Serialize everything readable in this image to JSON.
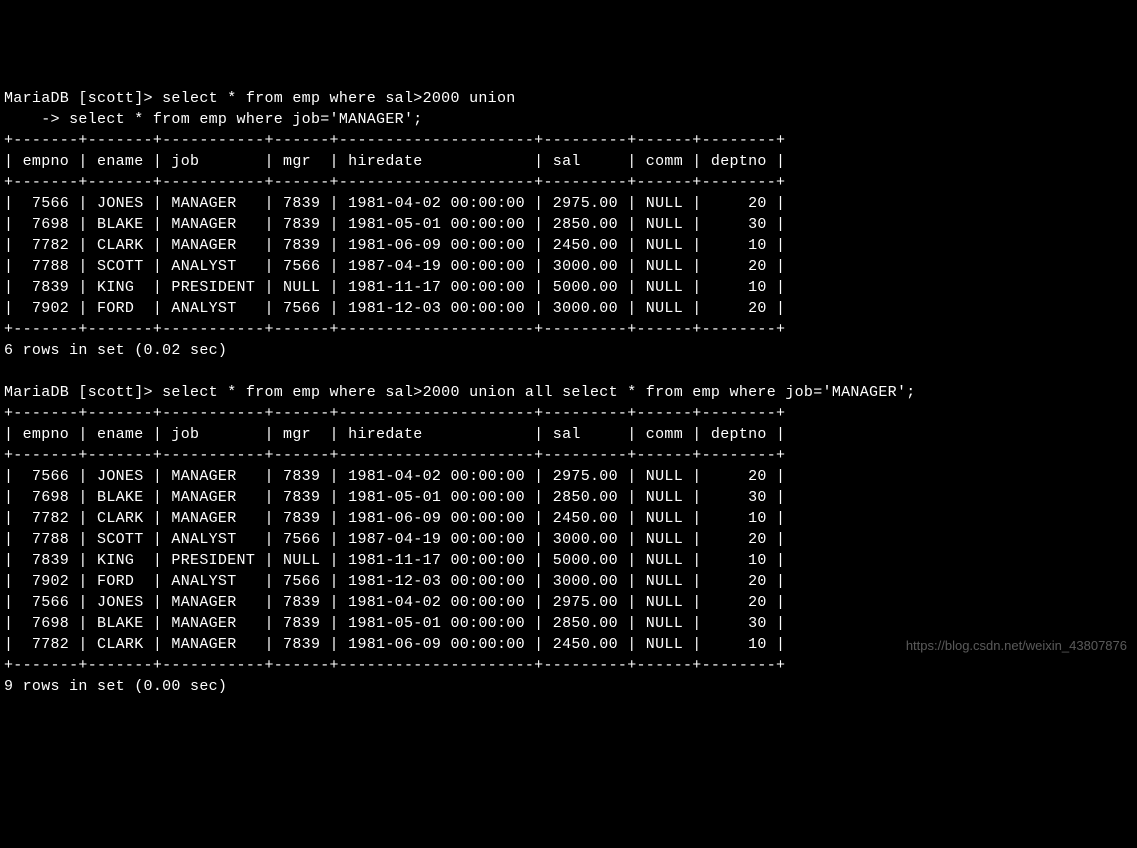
{
  "query1": {
    "prompt1": "MariaDB [scott]> select * from emp where sal>2000 union",
    "prompt2": "    -> select * from emp where job='MANAGER';",
    "sep": "+-------+-------+-----------+------+---------------------+---------+------+--------+",
    "header": "| empno | ename | job       | mgr  | hiredate            | sal     | comm | deptno |",
    "rows": [
      "|  7566 | JONES | MANAGER   | 7839 | 1981-04-02 00:00:00 | 2975.00 | NULL |     20 |",
      "|  7698 | BLAKE | MANAGER   | 7839 | 1981-05-01 00:00:00 | 2850.00 | NULL |     30 |",
      "|  7782 | CLARK | MANAGER   | 7839 | 1981-06-09 00:00:00 | 2450.00 | NULL |     10 |",
      "|  7788 | SCOTT | ANALYST   | 7566 | 1987-04-19 00:00:00 | 3000.00 | NULL |     20 |",
      "|  7839 | KING  | PRESIDENT | NULL | 1981-11-17 00:00:00 | 5000.00 | NULL |     10 |",
      "|  7902 | FORD  | ANALYST   | 7566 | 1981-12-03 00:00:00 | 3000.00 | NULL |     20 |"
    ],
    "footer": "6 rows in set (0.02 sec)"
  },
  "query2": {
    "prompt1": "MariaDB [scott]> select * from emp where sal>2000 union all select * from emp where job='MANAGER';",
    "sep": "+-------+-------+-----------+------+---------------------+---------+------+--------+",
    "header": "| empno | ename | job       | mgr  | hiredate            | sal     | comm | deptno |",
    "rows": [
      "|  7566 | JONES | MANAGER   | 7839 | 1981-04-02 00:00:00 | 2975.00 | NULL |     20 |",
      "|  7698 | BLAKE | MANAGER   | 7839 | 1981-05-01 00:00:00 | 2850.00 | NULL |     30 |",
      "|  7782 | CLARK | MANAGER   | 7839 | 1981-06-09 00:00:00 | 2450.00 | NULL |     10 |",
      "|  7788 | SCOTT | ANALYST   | 7566 | 1987-04-19 00:00:00 | 3000.00 | NULL |     20 |",
      "|  7839 | KING  | PRESIDENT | NULL | 1981-11-17 00:00:00 | 5000.00 | NULL |     10 |",
      "|  7902 | FORD  | ANALYST   | 7566 | 1981-12-03 00:00:00 | 3000.00 | NULL |     20 |",
      "|  7566 | JONES | MANAGER   | 7839 | 1981-04-02 00:00:00 | 2975.00 | NULL |     20 |",
      "|  7698 | BLAKE | MANAGER   | 7839 | 1981-05-01 00:00:00 | 2850.00 | NULL |     30 |",
      "|  7782 | CLARK | MANAGER   | 7839 | 1981-06-09 00:00:00 | 2450.00 | NULL |     10 |"
    ],
    "footer": "9 rows in set (0.00 sec)"
  },
  "watermark": "https://blog.csdn.net/weixin_43807876",
  "chart_data": {
    "type": "table",
    "note": "Two SQL result tables from MariaDB CLI (UNION vs UNION ALL on emp)",
    "columns": [
      "empno",
      "ename",
      "job",
      "mgr",
      "hiredate",
      "sal",
      "comm",
      "deptno"
    ],
    "result1": {
      "sql": "select * from emp where sal>2000 union select * from emp where job='MANAGER';",
      "rows": [
        [
          7566,
          "JONES",
          "MANAGER",
          7839,
          "1981-04-02 00:00:00",
          2975.0,
          null,
          20
        ],
        [
          7698,
          "BLAKE",
          "MANAGER",
          7839,
          "1981-05-01 00:00:00",
          2850.0,
          null,
          30
        ],
        [
          7782,
          "CLARK",
          "MANAGER",
          7839,
          "1981-06-09 00:00:00",
          2450.0,
          null,
          10
        ],
        [
          7788,
          "SCOTT",
          "ANALYST",
          7566,
          "1987-04-19 00:00:00",
          3000.0,
          null,
          20
        ],
        [
          7839,
          "KING",
          "PRESIDENT",
          null,
          "1981-11-17 00:00:00",
          5000.0,
          null,
          10
        ],
        [
          7902,
          "FORD",
          "ANALYST",
          7566,
          "1981-12-03 00:00:00",
          3000.0,
          null,
          20
        ]
      ],
      "rowcount": 6,
      "elapsed_sec": 0.02
    },
    "result2": {
      "sql": "select * from emp where sal>2000 union all select * from emp where job='MANAGER';",
      "rows": [
        [
          7566,
          "JONES",
          "MANAGER",
          7839,
          "1981-04-02 00:00:00",
          2975.0,
          null,
          20
        ],
        [
          7698,
          "BLAKE",
          "MANAGER",
          7839,
          "1981-05-01 00:00:00",
          2850.0,
          null,
          30
        ],
        [
          7782,
          "CLARK",
          "MANAGER",
          7839,
          "1981-06-09 00:00:00",
          2450.0,
          null,
          10
        ],
        [
          7788,
          "SCOTT",
          "ANALYST",
          7566,
          "1987-04-19 00:00:00",
          3000.0,
          null,
          20
        ],
        [
          7839,
          "KING",
          "PRESIDENT",
          null,
          "1981-11-17 00:00:00",
          5000.0,
          null,
          10
        ],
        [
          7902,
          "FORD",
          "ANALYST",
          7566,
          "1981-12-03 00:00:00",
          3000.0,
          null,
          20
        ],
        [
          7566,
          "JONES",
          "MANAGER",
          7839,
          "1981-04-02 00:00:00",
          2975.0,
          null,
          20
        ],
        [
          7698,
          "BLAKE",
          "MANAGER",
          7839,
          "1981-05-01 00:00:00",
          2850.0,
          null,
          30
        ],
        [
          7782,
          "CLARK",
          "MANAGER",
          7839,
          "1981-06-09 00:00:00",
          2450.0,
          null,
          10
        ]
      ],
      "rowcount": 9,
      "elapsed_sec": 0.0
    }
  }
}
